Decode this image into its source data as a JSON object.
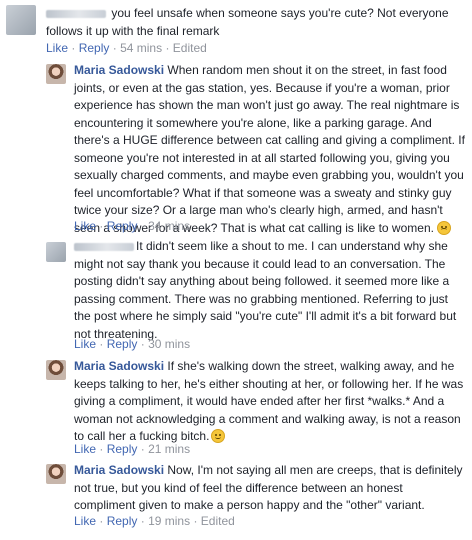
{
  "actions": {
    "like": "Like",
    "reply": "Reply",
    "sep": "·",
    "edited": "Edited"
  },
  "comments": [
    {
      "author": "",
      "text_lines": [
        "you feel unsafe when someone says you're cute? Not everyone",
        "follows it up with the final remark"
      ],
      "time": "54 mins"
    },
    {
      "author": "Maria Sadowski",
      "text_lines": [
        "When random men shout it on the street, in fast food",
        "joints, or even at the gas station, yes. Because if you're a woman, prior",
        "experience has shown the man won't just go away. The real nightmare is",
        "encountering it somewhere you're alone, like a parking garage. And",
        "there's a HUGE difference between cat calling and giving a compliment. If",
        "someone you're not interested in at all started following you, giving you",
        "sexually charged comments, and maybe even grabbing you, wouldn't you",
        "feel uncomfortable? What if that someone was a sweaty and stinky guy",
        "twice your size? Or a large man who's clearly high, armed, and hasn't",
        "seen a shower for a week? That is what cat calling is like to women."
      ],
      "time": "34 mins"
    },
    {
      "author": "",
      "text_lines": [
        "It didn't seem like a shout to me. I can understand why she",
        "might not say thank you because it could lead to an conversation. The",
        "posting didn't say anything about being followed. it seemed more like a",
        "passing comment. There was no grabbing mentioned. Referring to just",
        "the post where he simply said \"you're cute\" I'll admit it's a bit forward but",
        "not threatening."
      ],
      "time": "30 mins"
    },
    {
      "author": "Maria Sadowski",
      "text_lines": [
        "If she's walking down the street, walking away, and he",
        "keeps talking to her, he's either shouting at her, or following her. If he was",
        "giving a compliment, it would have ended after her first *walks.* And a",
        "woman not acknowledging a comment and walking away, is not a reason",
        "to call her a fucking bitch."
      ],
      "time": "21 mins"
    },
    {
      "author": "Maria Sadowski",
      "text_lines": [
        "Now, I'm not saying all men are creeps, that is definitely",
        "not true, but you kind of feel the difference between an honest",
        "compliment given to make a person happy and the \"other\" variant."
      ],
      "time": "19 mins"
    }
  ]
}
